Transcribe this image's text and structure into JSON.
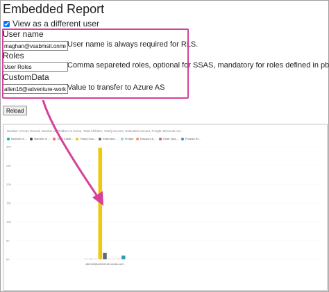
{
  "page": {
    "title": "Embedded Report",
    "checkbox_label": "View as a different user",
    "checkbox_checked": true,
    "reload_label": "Reload",
    "annotation_color": "#d6409b"
  },
  "fields": {
    "user_name": {
      "label": "User name",
      "value": "maghan@vsabmsit.onmicr",
      "note": "User name is always required for RLS."
    },
    "roles": {
      "label": "Roles",
      "value": "User Roles",
      "note": "Comma separeted roles, optional for SSAS, mandatory for roles defined in pbix"
    },
    "custom_data": {
      "label": "CustomData",
      "value": "allen16@adventure-works",
      "note": "Value to transfer to Azure AS"
    }
  },
  "chart_data": {
    "type": "bar",
    "title": "Number of Cars Owned, Number of Children At Home, Total Children, Yearly Income, Extended Amount, Freight, Discount Am...",
    "categories": [
      "allen16@adventure-works.com"
    ],
    "ylim": [
      0,
      30000
    ],
    "yticks": [
      "0K",
      "5K",
      "10K",
      "15K",
      "20K",
      "25K",
      "30K"
    ],
    "series": [
      {
        "name": "Number of ...",
        "color": "#01b8aa",
        "values": [
          0
        ]
      },
      {
        "name": "Number of ...",
        "color": "#374649",
        "values": [
          0
        ]
      },
      {
        "name": "Total Childr...",
        "color": "#fd625e",
        "values": [
          0
        ]
      },
      {
        "name": "Yearly Inco...",
        "color": "#f2c80f",
        "values": [
          29700
        ]
      },
      {
        "name": "Extended ...",
        "color": "#5f6b6d",
        "values": [
          1700
        ]
      },
      {
        "name": "Freight",
        "color": "#8ad4eb",
        "values": [
          40
        ]
      },
      {
        "name": "Discount A...",
        "color": "#fe9666",
        "values": [
          0
        ]
      },
      {
        "name": "Order Qua...",
        "color": "#a66999",
        "values": [
          0
        ]
      },
      {
        "name": "Product St...",
        "color": "#3599b8",
        "values": [
          1000
        ]
      }
    ]
  }
}
